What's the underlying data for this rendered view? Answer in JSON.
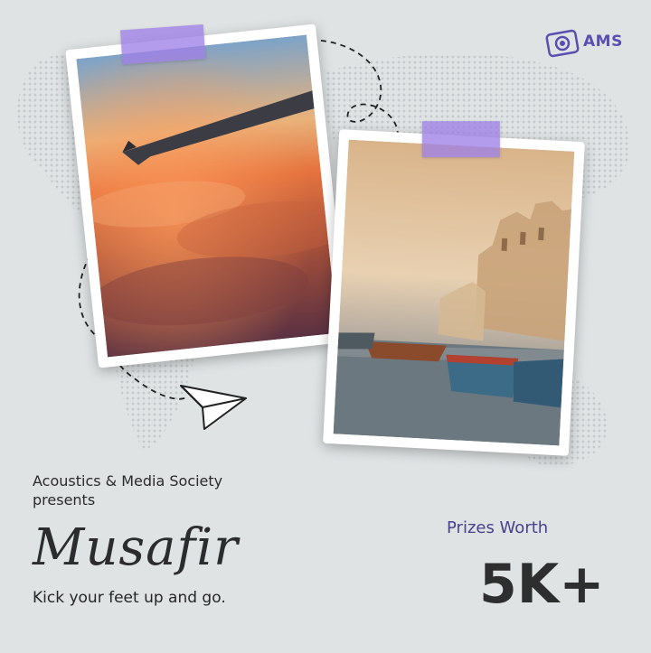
{
  "logo": {
    "text": "AMS",
    "icon": "camera-icon"
  },
  "presenter": "Acoustics & Media Society presents",
  "event_title": "Musafir",
  "tagline": "Kick your feet up and go.",
  "prize": {
    "label": "Prizes Worth",
    "value": "5K+"
  },
  "colors": {
    "background": "#dfe3e4",
    "accent": "#5a4fb0",
    "tape": "#9e80e6",
    "text": "#2b2b2b"
  }
}
